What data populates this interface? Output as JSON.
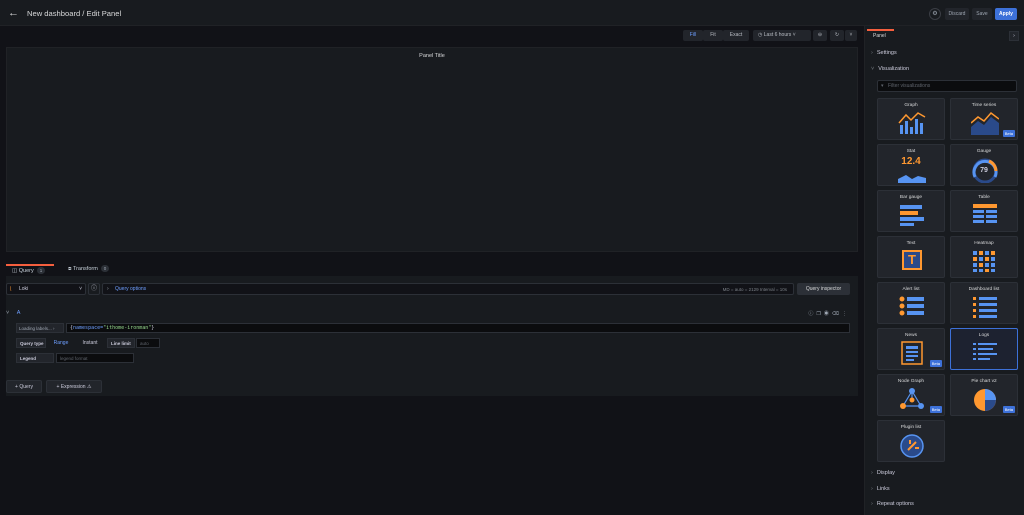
{
  "header": {
    "title": "New dashboard / Edit Panel",
    "discard": "Discard",
    "save": "Save",
    "apply": "Apply"
  },
  "toolbar": {
    "fill": "Fill",
    "fit": "Fit",
    "exact": "Exact",
    "time_range": "Last 6 hours"
  },
  "panel": {
    "title": "Panel Title"
  },
  "query_tabs": [
    {
      "label": "Query",
      "count": "1"
    },
    {
      "label": "Transform",
      "count": "0"
    }
  ],
  "datasource": {
    "name": "Loki"
  },
  "query_options": {
    "label": "Query options",
    "meta": "MD = auto = 2129    Interval = 10s"
  },
  "query_inspector": "Query inspector",
  "query": {
    "ref": "A",
    "label_browser": "Loading labels...",
    "expr_open": "{",
    "expr_key": "namespace=",
    "expr_value": "\"ithome-ironman\"",
    "expr_close": "}",
    "query_type_label": "Query type",
    "range": "Range",
    "instant": "Instant",
    "line_limit_label": "Line limit",
    "line_limit_placeholder": "auto",
    "legend_label": "Legend",
    "legend_placeholder": "legend format"
  },
  "actions": {
    "add_query": "Query",
    "add_expression": "Expression"
  },
  "sidebar": {
    "tab": "Panel",
    "settings": "Settings",
    "visualization": "Visualization",
    "filter_placeholder": "Filter visualizations",
    "display": "Display",
    "links": "Links",
    "repeat": "Repeat options",
    "viz": [
      {
        "name": "Graph"
      },
      {
        "name": "Time series",
        "badge": "Beta"
      },
      {
        "name": "Stat",
        "value": "12.4"
      },
      {
        "name": "Gauge",
        "value": "79"
      },
      {
        "name": "Bar gauge"
      },
      {
        "name": "Table"
      },
      {
        "name": "Text",
        "glyph": "T"
      },
      {
        "name": "Heatmap"
      },
      {
        "name": "Alert list"
      },
      {
        "name": "Dashboard list"
      },
      {
        "name": "News",
        "badge": "Beta"
      },
      {
        "name": "Logs"
      },
      {
        "name": "Node Graph",
        "badge": "Beta"
      },
      {
        "name": "Pie chart v2",
        "badge": "Beta"
      },
      {
        "name": "Plugin list"
      }
    ]
  },
  "colors": {
    "accent": "#3d71d9",
    "tab_active": "#f55f3e",
    "orange": "#ff9830",
    "blue": "#5794f2"
  }
}
